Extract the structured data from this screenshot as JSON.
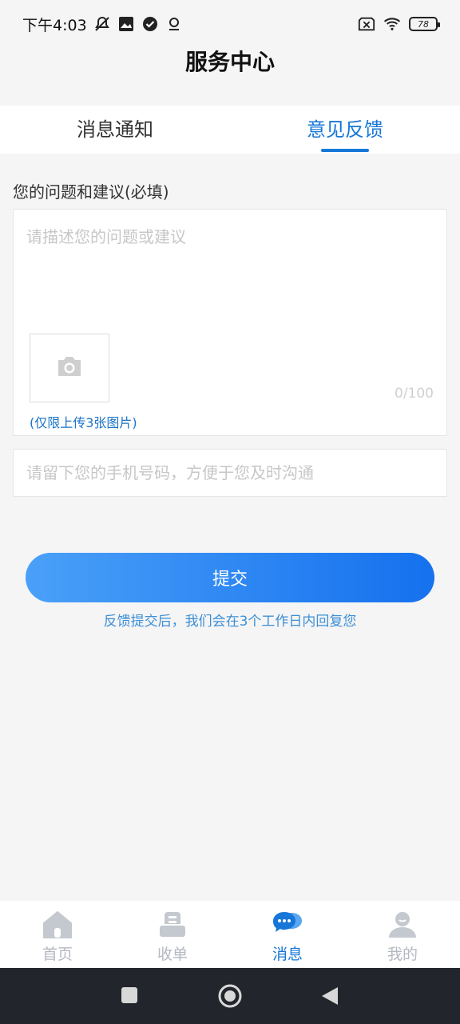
{
  "status_bar": {
    "time": "下午4:03",
    "battery": "78",
    "icons": [
      "mute-icon",
      "image-icon",
      "check-circle-icon",
      "location-icon",
      "sim-off-icon",
      "wifi-icon",
      "battery-icon"
    ]
  },
  "header": {
    "title": "服务中心"
  },
  "tabs": [
    {
      "label": "消息通知",
      "active": false
    },
    {
      "label": "意见反馈",
      "active": true
    }
  ],
  "form": {
    "label": "您的问题和建议(必填)",
    "feedback_placeholder": "请描述您的问题或建议",
    "counter": "0/100",
    "upload_hint": "(仅限上传3张图片)",
    "phone_placeholder": "请留下您的手机号码，方便于您及时沟通",
    "phone_value": ""
  },
  "submit": {
    "label": "提交",
    "note": "反馈提交后，我们会在3个工作日内回复您"
  },
  "bottom_nav": [
    {
      "label": "首页",
      "icon": "home-icon",
      "active": false
    },
    {
      "label": "收单",
      "icon": "receipt-icon",
      "active": false
    },
    {
      "label": "消息",
      "icon": "chat-icon",
      "active": true
    },
    {
      "label": "我的",
      "icon": "user-icon",
      "active": false
    }
  ],
  "colors": {
    "accent": "#1677d8",
    "button_gradient_start": "#4aa0f8",
    "button_gradient_end": "#1571ee",
    "inactive_nav": "#b4b8c0"
  }
}
